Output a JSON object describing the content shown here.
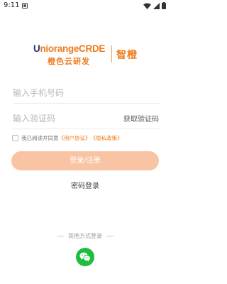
{
  "status_bar": {
    "time": "9:11"
  },
  "logo": {
    "brand_first": "U",
    "brand_rest": "niorangeCRDE",
    "sub_text": "橙色云研发",
    "cn_text": "智橙"
  },
  "phone": {
    "placeholder": "输入手机号码"
  },
  "code": {
    "placeholder": "输入验证码",
    "get_code_label": "获取验证码"
  },
  "agreement": {
    "text": "我已阅读并同意",
    "user_agreement": "《用户协议》",
    "privacy_policy": "《隐私政策》"
  },
  "login_button": {
    "label": "登录/注册"
  },
  "password_login": {
    "label": "密码登录"
  },
  "other_login": {
    "title": "其他方式登录",
    "wechat_icon": "wechat-icon"
  },
  "colors": {
    "accent": "#ef7b1c",
    "button": "#f9c4a3",
    "wechat": "#1fbd3f",
    "brand_blue": "#1f3c73"
  }
}
